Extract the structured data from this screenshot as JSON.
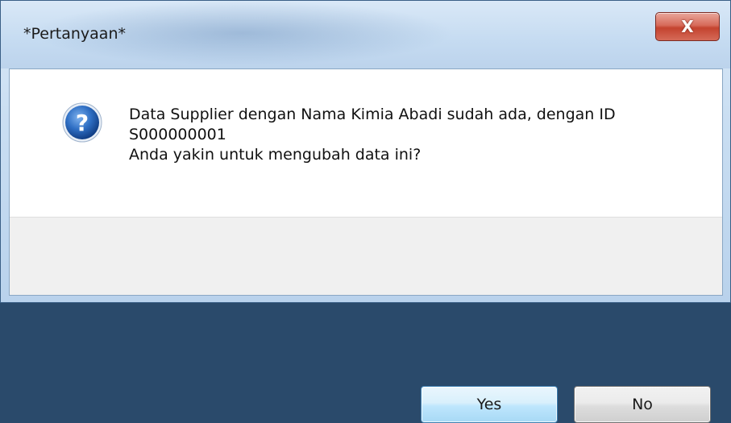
{
  "window": {
    "title": "*Pertanyaan*",
    "close_symbol": "X"
  },
  "dialog": {
    "icon": "question-icon",
    "message_lines": [
      "Data Supplier dengan Nama Kimia Abadi sudah ada, dengan ID",
      "S000000001",
      "Anda yakin untuk mengubah data ini?"
    ]
  },
  "buttons": {
    "yes_label": "Yes",
    "no_label": "No"
  },
  "colors": {
    "close_button": "#c4432f",
    "default_button": "#bee6fd",
    "question_icon": "#1f5aa6"
  }
}
